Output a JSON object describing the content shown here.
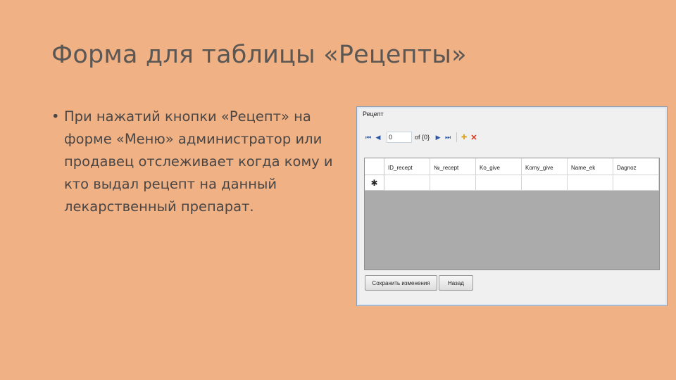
{
  "slide": {
    "title": "Форма для таблицы «Рецепты»",
    "bullet": "При нажатий кнопки «Рецепт» на форме «Меню» администратор или продавец отслеживает когда кому и кто выдал рецепт на данный лекарственный препарат."
  },
  "window": {
    "title": "Рецепт",
    "toolbar": {
      "position_value": "0",
      "of_label": "of {0}"
    },
    "grid": {
      "columns": [
        "ID_recept",
        "№_recept",
        "Ko_give",
        "Komy_give",
        "Name_ek",
        "Dagnoz"
      ],
      "new_row_marker": "✱"
    },
    "buttons": {
      "save": "Сохранить изменения",
      "back": "Назад"
    }
  }
}
